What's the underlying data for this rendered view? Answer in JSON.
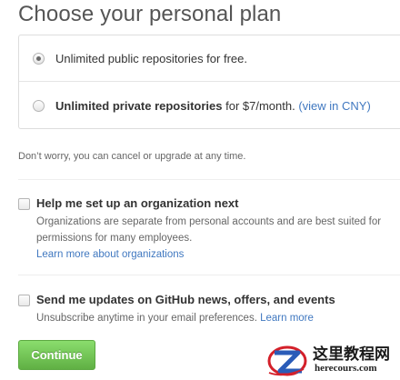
{
  "page": {
    "title": "Choose your personal plan"
  },
  "plans": [
    {
      "label_plain": "Unlimited public repositories for free.",
      "selected": true
    },
    {
      "label_bold": "Unlimited private repositories",
      "label_rest": " for $7/month. ",
      "link": "(view in CNY)",
      "selected": false
    }
  ],
  "note": "Don’t worry, you can cancel or upgrade at any time.",
  "options": {
    "organization": {
      "title": "Help me set up an organization next",
      "desc_line1": "Organizations are separate from personal accounts and are best suited for",
      "desc_line2": "permissions for many employees.",
      "link": "Learn more about organizations",
      "checked": false
    },
    "updates": {
      "title": "Send me updates on GitHub news, offers, and events",
      "desc": "Unsubscribe anytime in your email preferences. ",
      "link": "Learn more",
      "checked": false
    }
  },
  "actions": {
    "continue_label": "Continue"
  },
  "watermark": {
    "site_name": "这里教程网",
    "url": "herecours.com"
  },
  "colors": {
    "link": "#4078c0",
    "button_green": "#60b044"
  }
}
